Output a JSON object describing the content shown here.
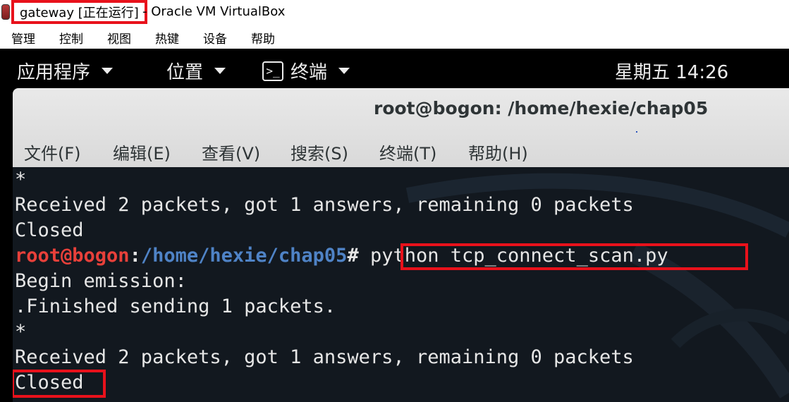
{
  "host_window": {
    "title_highlight": "gateway [正在运行]",
    "title_rest": "- Oracle VM VirtualBox"
  },
  "host_menu": [
    "管理",
    "控制",
    "视图",
    "热键",
    "设备",
    "帮助"
  ],
  "guest_topbar": {
    "applications": "应用程序",
    "places": "位置",
    "terminal": "终端",
    "terminal_icon_glyph": ">_",
    "clock": "星期五 14:26"
  },
  "terminal": {
    "title": "root@bogon: /home/hexie/chap05",
    "menu": [
      "文件(F)",
      "编辑(E)",
      "查看(V)",
      "搜索(S)",
      "终端(T)",
      "帮助(H)"
    ],
    "lines": [
      "*",
      "Received 2 packets, got 1 answers, remaining 0 packets",
      "Closed",
      "",
      "Begin emission:",
      ".Finished sending 1 packets.",
      "*",
      "Received 2 packets, got 1 answers, remaining 0 packets",
      "Closed"
    ],
    "prompt": {
      "user_host": "root@bogon",
      "colon": ":",
      "path": "/home/hexie/chap05",
      "hash": "#",
      "command": "python tcp_connect_scan.py"
    }
  },
  "colors": {
    "highlight_red": "#e8111b",
    "prompt_user": "#e8403a",
    "prompt_path": "#4f83c6",
    "terminal_bg": "#12181f",
    "terminal_fg": "#e6e6e6"
  },
  "icons": {
    "host_app": "virtualbox-icon",
    "dropdown": "caret-down-icon",
    "terminal": "terminal-icon"
  }
}
